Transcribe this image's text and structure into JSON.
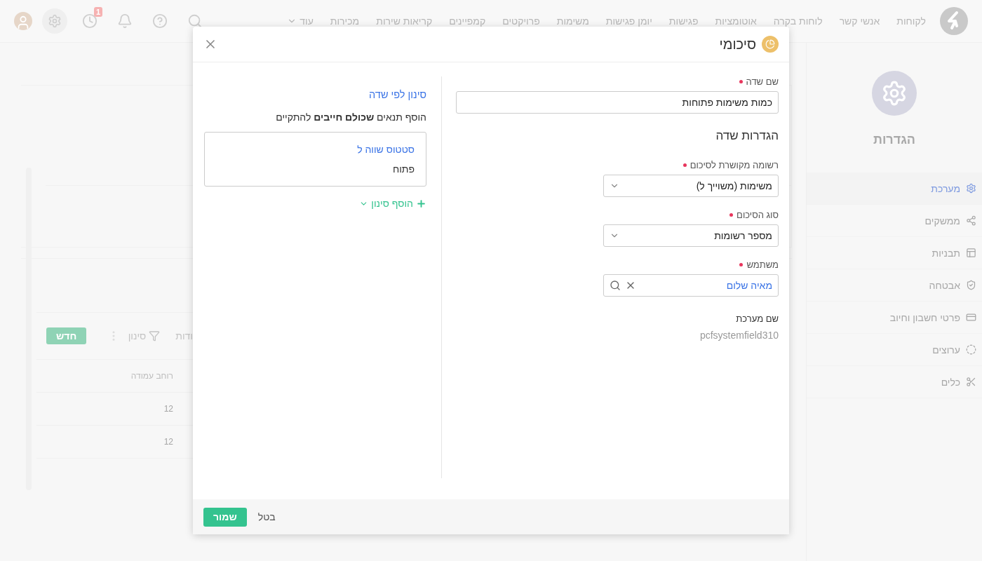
{
  "top_nav": {
    "items": [
      "לקוחות",
      "אנשי קשר",
      "לוחות בקרה",
      "אוטומציות",
      "פגישות",
      "יומן פגישות",
      "משימות",
      "פרויקטים",
      "קמפיינים",
      "קריאות שירות",
      "מכירות"
    ],
    "more": "עוד",
    "notifications_badge": "1"
  },
  "settings_sidebar": {
    "title": "הגדרות",
    "items": [
      {
        "label": "מערכת",
        "selected": true
      },
      {
        "label": "ממשקים",
        "selected": false
      },
      {
        "label": "תבניות",
        "selected": false
      },
      {
        "label": "אבטחה",
        "selected": false
      },
      {
        "label": "פרטי חשבון וחיוב",
        "selected": false
      },
      {
        "label": "ערוצים",
        "selected": false
      },
      {
        "label": "כלים",
        "selected": false
      }
    ]
  },
  "background_list": {
    "toolbar": {
      "cut_label": "ודות",
      "filter": "סינון",
      "new_button": "חדש"
    },
    "table": {
      "columns": [
        "רוחב עמודה"
      ],
      "rows": [
        [
          "12"
        ],
        [
          "12"
        ]
      ]
    }
  },
  "dialog": {
    "title": "סיכומי",
    "name_field": {
      "label": "שם שדה",
      "required": true,
      "value": "כמות משימות פתוחות"
    },
    "settings_heading": "הגדרות שדה",
    "fields": [
      {
        "kind": "select",
        "label": "רשומה מקושרת לסיכום",
        "required": true,
        "value": "משימות (משוייך ל)"
      },
      {
        "kind": "select",
        "label": "סוג הסיכום",
        "required": true,
        "value": "מספר רשומות"
      },
      {
        "kind": "lookup",
        "label": "משתמש",
        "required": true,
        "value": "מאיה שלום"
      },
      {
        "kind": "readonly",
        "label": "שם מערכת",
        "required": false,
        "value": "pcfsystemfield310"
      }
    ],
    "filter": {
      "title": "סינון לפי שדה",
      "hint": "הוסף תנאים **שכולם חייבים** להתקיים",
      "conditions": [
        {
          "field": "סטטוס שווה ל",
          "value": "פתוח"
        }
      ],
      "add_filter": "הוסף סינון"
    },
    "buttons": {
      "cancel": "בטל",
      "save": "שמור"
    }
  }
}
